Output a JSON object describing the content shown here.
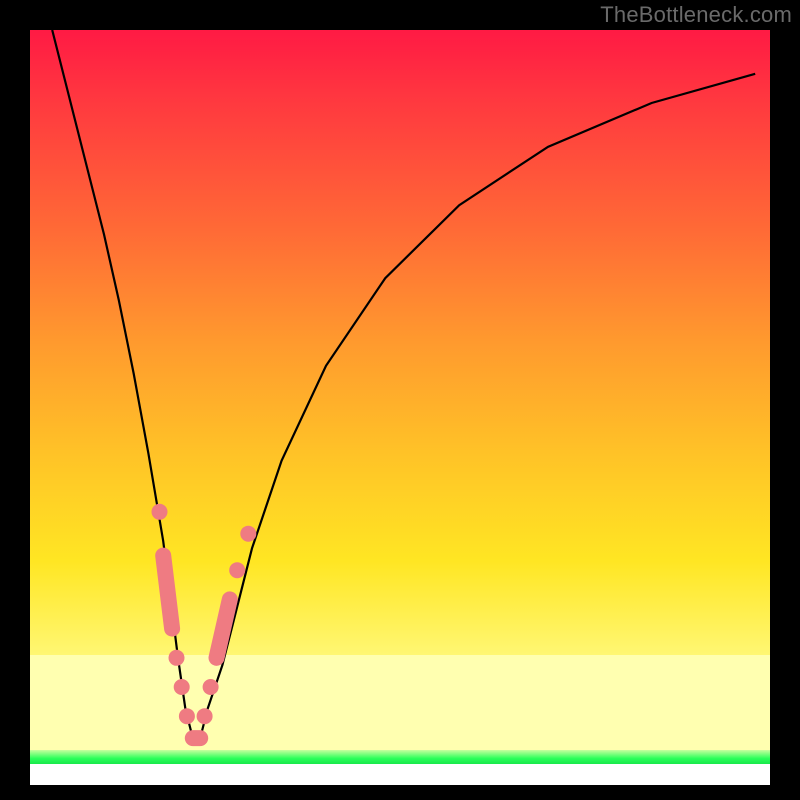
{
  "watermark": "TheBottleneck.com",
  "colors": {
    "marker": "#ef7b82",
    "curve": "#000000",
    "grad_top": "#ff1a44",
    "grad_bottom": "#fff773",
    "pale_band": "#ffffb0",
    "green_band": "#2bff5a"
  },
  "chart_data": {
    "type": "line",
    "title": "",
    "xlabel": "",
    "ylabel": "",
    "xlim": [
      0,
      100
    ],
    "ylim": [
      0,
      100
    ],
    "note": "No axis ticks or labels are rendered in the image; values estimated from normalized 0-100 plot coordinates (0,0 = bottom-left of colored plot area). The curve is a V/valley shape with minimum near x≈22.",
    "series": [
      {
        "name": "bottleneck-curve",
        "x": [
          3,
          5,
          8,
          10,
          12,
          14,
          16,
          18,
          19,
          20,
          21,
          22,
          23,
          24,
          26,
          28,
          30,
          34,
          40,
          48,
          58,
          70,
          84,
          98
        ],
        "y": [
          100,
          92,
          80,
          72,
          63,
          53,
          42,
          30,
          22,
          14,
          7,
          3,
          3,
          7,
          13,
          21,
          29,
          41,
          54,
          66,
          76,
          84,
          90,
          94
        ]
      }
    ],
    "markers": {
      "note": "Salmon dots/pills clustered on both flanks of the valley, roughly y∈[3,30].",
      "points": [
        {
          "x": 17.5,
          "y": 34,
          "kind": "dot"
        },
        {
          "x": 18.0,
          "y": 28,
          "kind": "pill_start"
        },
        {
          "x": 19.2,
          "y": 18,
          "kind": "pill_end"
        },
        {
          "x": 19.8,
          "y": 14,
          "kind": "dot"
        },
        {
          "x": 20.5,
          "y": 10,
          "kind": "dot"
        },
        {
          "x": 21.2,
          "y": 6,
          "kind": "dot"
        },
        {
          "x": 22.0,
          "y": 3,
          "kind": "pill_start"
        },
        {
          "x": 23.0,
          "y": 3,
          "kind": "pill_end"
        },
        {
          "x": 23.6,
          "y": 6,
          "kind": "dot"
        },
        {
          "x": 24.4,
          "y": 10,
          "kind": "dot"
        },
        {
          "x": 25.2,
          "y": 14,
          "kind": "pill_start"
        },
        {
          "x": 27.0,
          "y": 22,
          "kind": "pill_end"
        },
        {
          "x": 28.0,
          "y": 26,
          "kind": "dot"
        },
        {
          "x": 29.5,
          "y": 31,
          "kind": "dot"
        }
      ]
    }
  }
}
